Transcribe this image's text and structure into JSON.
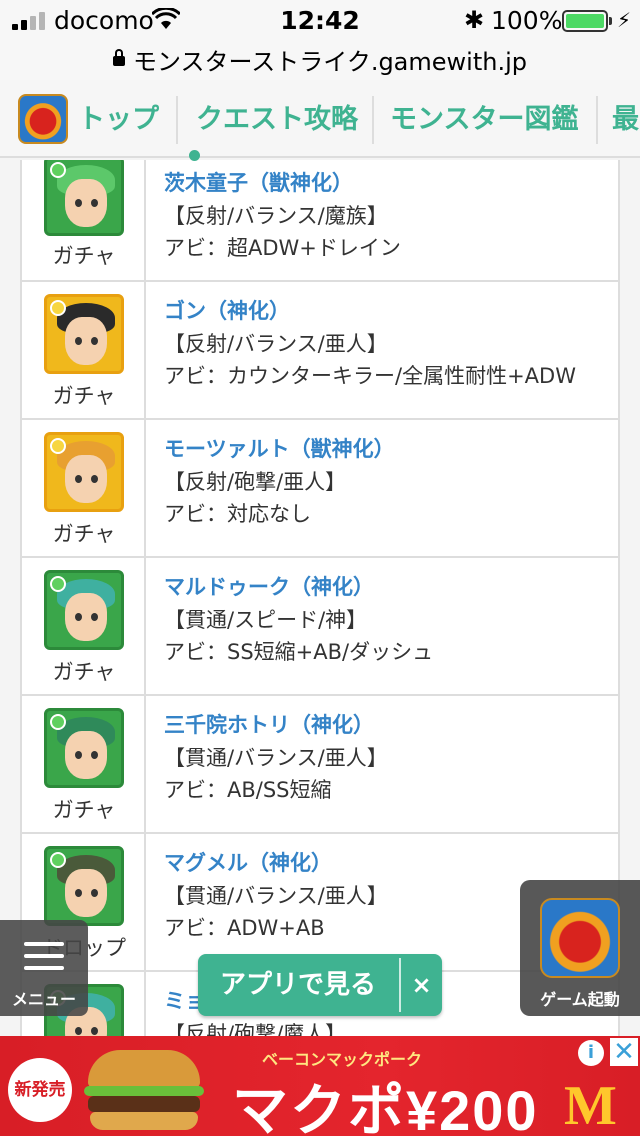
{
  "status_bar": {
    "carrier": "docomo",
    "time": "12:42",
    "bluetooth_icon": "✱",
    "battery_percent": "100%",
    "battery_level": 1.0
  },
  "url_bar": {
    "url": "モンスターストライク.gamewith.jp"
  },
  "site_nav": {
    "items": [
      {
        "label": "トップ"
      },
      {
        "label": "クエスト攻略"
      },
      {
        "label": "モンスター図鑑"
      },
      {
        "label": "最"
      }
    ],
    "accent_color": "#3fb391"
  },
  "monsters": [
    {
      "name": "茨木童子（獣神化）",
      "type": "【反射/バランス/魔族】",
      "ability": "アビ：超ADW+ドレイン",
      "source": "ガチャ",
      "frame": "#3aa64a",
      "hair": "#5cc86a"
    },
    {
      "name": "ゴン（神化）",
      "type": "【反射/バランス/亜人】",
      "ability": "アビ：カウンターキラー/全属性耐性+ADW",
      "source": "ガチャ",
      "frame": "#f0b81c",
      "hair": "#2a2a2a"
    },
    {
      "name": "モーツァルト（獣神化）",
      "type": "【反射/砲撃/亜人】",
      "ability": "アビ：対応なし",
      "source": "ガチャ",
      "frame": "#f0b81c",
      "hair": "#e8a030"
    },
    {
      "name": "マルドゥーク（神化）",
      "type": "【貫通/スピード/神】",
      "ability": "アビ：SS短縮+AB/ダッシュ",
      "source": "ガチャ",
      "frame": "#3aa64a",
      "hair": "#3fb0a0"
    },
    {
      "name": "三千院ホトリ（神化）",
      "type": "【貫通/バランス/亜人】",
      "ability": "アビ：AB/SS短縮",
      "source": "ガチャ",
      "frame": "#3aa64a",
      "hair": "#2f8a5a"
    },
    {
      "name": "マグメル（神化）",
      "type": "【貫通/バランス/亜人】",
      "ability": "アビ：ADW+AB",
      "source": "ドロップ",
      "frame": "#3aa64a",
      "hair": "#4a5a3a"
    },
    {
      "name": "ミョ…",
      "type": "【反射/砲撃/魔人】",
      "ability": "",
      "source": "",
      "frame": "#3aa64a",
      "hair": "#3fb0a0"
    }
  ],
  "menu_button": {
    "label": "メニュー",
    "icon": "hamburger-icon"
  },
  "game_button": {
    "label": "ゲーム起動",
    "icon": "monster-strike-app-icon"
  },
  "app_button": {
    "label": "アプリで見る",
    "close": "×"
  },
  "ad": {
    "badge": "新発売",
    "subtitle": "ベーコンマックポーク",
    "headline": "マクポ¥200",
    "brand_logo": "M",
    "info": "i",
    "close": "✕",
    "bg_color": "#d81e26"
  }
}
